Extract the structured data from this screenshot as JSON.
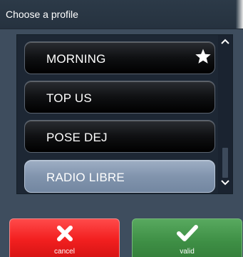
{
  "dialog": {
    "title": "Choose a profile"
  },
  "profiles": [
    {
      "label": "MORNING",
      "favorite": true,
      "selected": false
    },
    {
      "label": "TOP US",
      "favorite": false,
      "selected": false
    },
    {
      "label": "POSE DEJ",
      "favorite": false,
      "selected": false
    },
    {
      "label": "RADIO LIBRE",
      "favorite": false,
      "selected": true
    }
  ],
  "icons": {
    "favorite": "star-icon",
    "scroll_up": "chevron-up-icon",
    "scroll_down": "chevron-down-icon",
    "cancel": "close-icon",
    "valid": "checkmark-icon"
  },
  "actions": {
    "cancel_label": "cancel",
    "valid_label": "valid"
  },
  "colors": {
    "background": "#3e4d5e",
    "title_bar": "#2c3a48",
    "list_background": "#1d2734",
    "selected_item": "#8194ad",
    "cancel": "#f21f1f",
    "valid": "#3e8f45"
  }
}
